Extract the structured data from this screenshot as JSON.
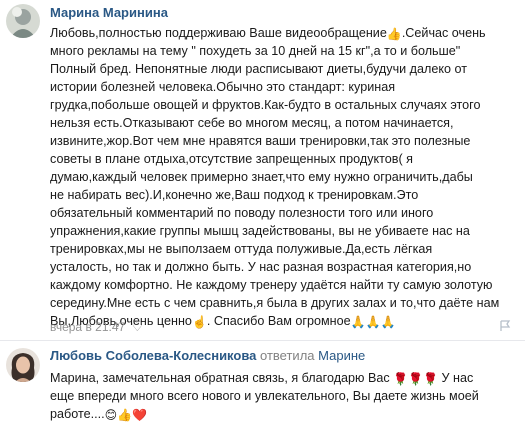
{
  "comment1": {
    "author": "Марина Маринина",
    "lines": [
      "Любовь,полностью поддерживаю Ваше видеообращение",
      "много рекламы на тему \" похудеть за 10 дней на 15 кг\",а то и больше\"",
      "Полный бред. Непонятные люди расписывают диеты,будучи далеко от",
      "истории болезней человека.Обычно это стандарт: куриная",
      "грудка,побольше овощей и фруктов.Как-будто в остальных случаях этого",
      "нельзя есть.Отказывают себе во многом месяц, а потом начинается,",
      "извините,жор.Вот чем мне нравятся ваши тренировки,так это полезные",
      "советы в плане отдыха,отсутствие запрещенных продуктов( я",
      "думаю,каждый человек примерно знает,что ему нужно ограничить,дабы",
      "не набирать вес).И,конечно же,Ваш подход к тренировкам.Это",
      "обязательный комментарий по поводу полезности того или иного",
      "упражнения,какие группы мышц задействованы, вы не убиваете нас на",
      "тренировках,мы не выползаем оттуда полуживые.Да,есть лёгкая",
      "усталость, но так и должно быть. У нас разная возрастная категория,но",
      "каждому комфортно. Не каждому тренеру удаётся найти ту самую золотую",
      "середину.Мне есть с чем сравнить,я была в других залах и то,что даёте нам",
      "Вы,Любовь,очень ценно",
      ". Спасибо Вам огромное"
    ],
    "line1_tail": ".Сейчас очень",
    "emoji_thumbs": "👍",
    "emoji_finger": "☝️",
    "emoji_pray": "🙏🙏🙏",
    "date": "вчера в 21:47",
    "like_icon": "heart-icon",
    "report_label": "Пожаловаться"
  },
  "comment2": {
    "author": "Любовь Соболева-Колесникова",
    "reply_verb": "ответила",
    "reply_to": "Марине",
    "line1": "Марина, замечательная обратная связь, я благодарю Вас",
    "line1_tail": "У нас",
    "line2": "еще впереди много всего нового и увлекательного, Вы даете жизнь моей",
    "line3": "работе....",
    "emoji_roses": "🌹🌹🌹",
    "emoji_end": "😊👍❤️"
  },
  "colors": {
    "link": "#2a5885",
    "meta": "#939393",
    "divider": "#e7e8ec"
  }
}
